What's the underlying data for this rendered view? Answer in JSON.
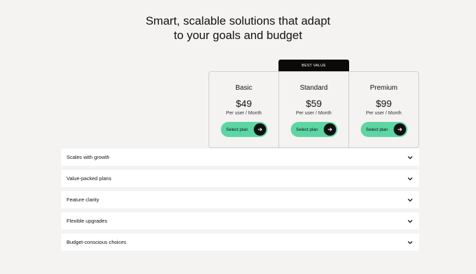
{
  "headline": {
    "line1": "Smart, scalable solutions that adapt",
    "line2": "to your goals and budget"
  },
  "badge": {
    "label": "BEST VALUE"
  },
  "plans": [
    {
      "name": "Basic",
      "price": "$49",
      "unit": "Per user / Month",
      "cta": "Select plan"
    },
    {
      "name": "Standard",
      "price": "$59",
      "unit": "Per user / Month",
      "cta": "Select plan"
    },
    {
      "name": "Premium",
      "price": "$99",
      "unit": "Per user / Month",
      "cta": "Select plan"
    }
  ],
  "accordion": [
    {
      "label": "Scales with growth"
    },
    {
      "label": "Value-packed plans"
    },
    {
      "label": "Feature clarity"
    },
    {
      "label": "Flexible upgrades"
    },
    {
      "label": "Budget-conscious choices"
    }
  ],
  "icons": {
    "cta_arrow": "arrow-right-icon",
    "accordion_toggle": "chevron-down-icon"
  },
  "colors": {
    "background": "#f4f3f1",
    "accent_green": "#5cd6a3",
    "badge_black": "#0a0a0a",
    "card_white": "#ffffff"
  }
}
